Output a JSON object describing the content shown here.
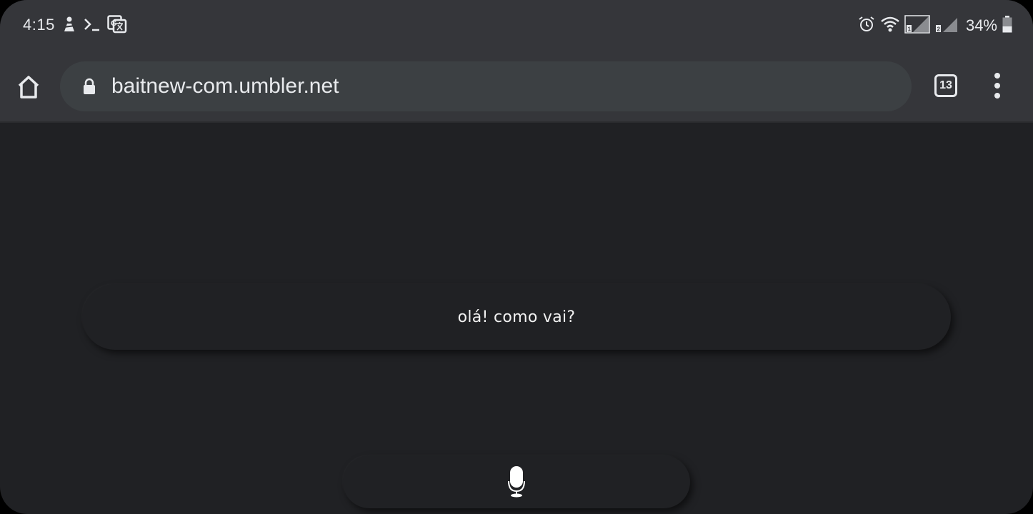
{
  "status_bar": {
    "time": "4:15",
    "battery_percent": "34%",
    "battery_level": 0.34,
    "left_icons": [
      "app-notification-icon",
      "terminal-icon",
      "translate-icon"
    ],
    "right_icons": [
      "alarm-icon",
      "wifi-icon",
      "sim1-signal-icon",
      "sim2-signal-icon",
      "battery-icon"
    ]
  },
  "toolbar": {
    "url": "baitnew-com.umbler.net",
    "tab_count": "13"
  },
  "content": {
    "message": "olá! como vai?"
  },
  "colors": {
    "page_background": "#202124",
    "toolbar_background": "#35363a",
    "omnibox_background": "#3c4043",
    "text": "#e8eaed"
  }
}
